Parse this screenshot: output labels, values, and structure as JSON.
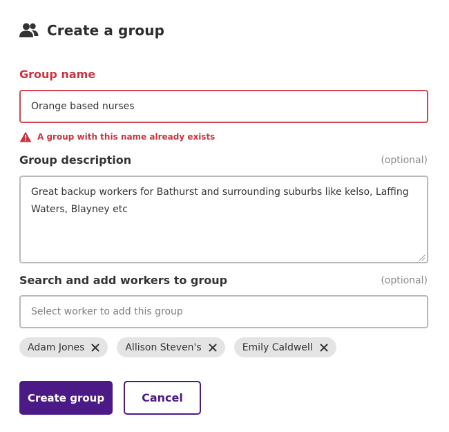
{
  "header": {
    "title": "Create a group",
    "icon": "users-icon"
  },
  "group_name": {
    "label": "Group name",
    "value": "Orange based nurses",
    "error": "A group with this name already exists",
    "error_color": "#cc3340"
  },
  "group_description": {
    "label": "Group description",
    "optional": "(optional)",
    "value": "Great backup workers for Bathurst and surrounding suburbs like kelso, Laffing Waters, Blayney etc"
  },
  "workers": {
    "label": "Search and add workers to group",
    "optional": "(optional)",
    "placeholder": "Select worker to add this group",
    "selected": [
      "Adam Jones",
      "Allison Steven's",
      "Emily Caldwell"
    ]
  },
  "actions": {
    "create_label": "Create group",
    "cancel_label": "Cancel",
    "accent": "#4b1a87"
  }
}
